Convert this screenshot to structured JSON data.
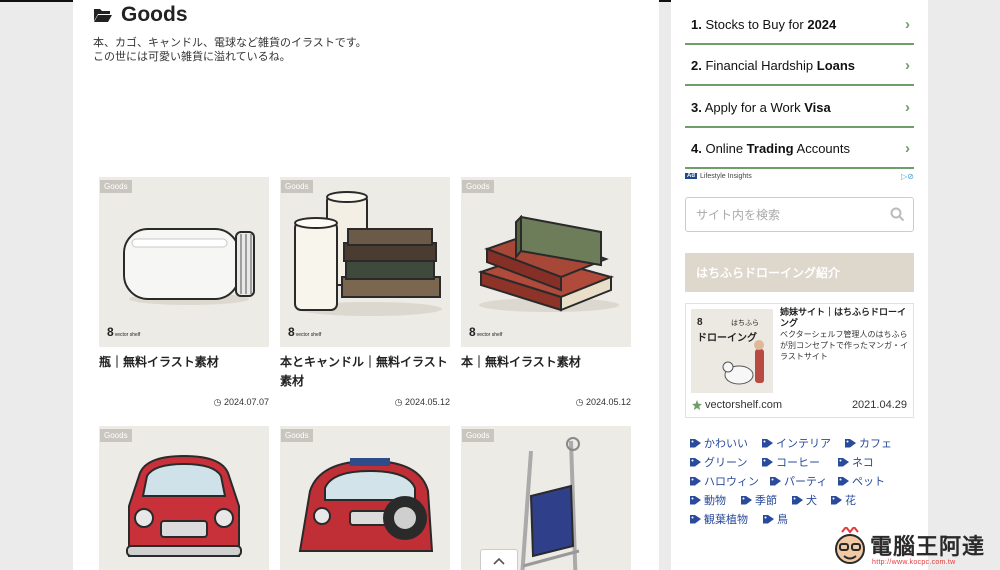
{
  "main": {
    "title": "Goods",
    "description_line1": "本、カゴ、キャンドル、電球など雑貨のイラストです。",
    "description_line2": "この世には可愛い雑貨に溢れているね。",
    "badge_label": "Goods",
    "cards": [
      {
        "title": "瓶｜無料イラスト素材",
        "date": "2024.07.07",
        "icon": "jar"
      },
      {
        "title": "本とキャンドル｜無料イラスト素材",
        "date": "2024.05.12",
        "icon": "books-and-candles"
      },
      {
        "title": "本｜無料イラスト素材",
        "date": "2024.05.12",
        "icon": "books"
      },
      {
        "title": "",
        "date": "",
        "icon": "red-mini-car"
      },
      {
        "title": "",
        "date": "",
        "icon": "red-mini-car-front"
      },
      {
        "title": "",
        "date": "",
        "icon": "folding-chair"
      }
    ]
  },
  "sidebar": {
    "ranking": [
      {
        "num": "1.",
        "pre": "Stocks to Buy for ",
        "bold": "2024",
        "post": ""
      },
      {
        "num": "2.",
        "pre": "Financial Hardship ",
        "bold": "Loans",
        "post": ""
      },
      {
        "num": "3.",
        "pre": "Apply for a Work ",
        "bold": "Visa",
        "post": ""
      },
      {
        "num": "4.",
        "pre": "Online ",
        "bold": "Trading",
        "post": " Accounts"
      }
    ],
    "ad_badge": "Ad",
    "ad_source": "Lifestyle Insights",
    "search_placeholder": "サイト内を検索",
    "heading": "はちふらドローイング紹介",
    "promo": {
      "title": "姉妹サイト｜はちふらドローイング",
      "description": "ベクターシェルフ管理人のはちふらが別コンセプトで作ったマンガ・イラストサイト",
      "image_label_small": "はちふら",
      "image_label_big": "ドローイング",
      "site": "vectorshelf.com",
      "date": "2021.04.29"
    },
    "tags": [
      "かわいい",
      "インテリア",
      "カフェ",
      "グリーン",
      "コーヒー",
      "ネコ",
      "ハロウィン",
      "パーティ",
      "ペット",
      "動物",
      "季節",
      "犬",
      "花",
      "観葉植物",
      "鳥"
    ]
  },
  "watermark": {
    "text": "電腦王阿達",
    "url": "http://www.kocpc.com.tw"
  },
  "colors": {
    "accent_green": "#6f9e6b",
    "tag_blue": "#2a4b9b",
    "heading_bg": "#ddd7cc"
  }
}
